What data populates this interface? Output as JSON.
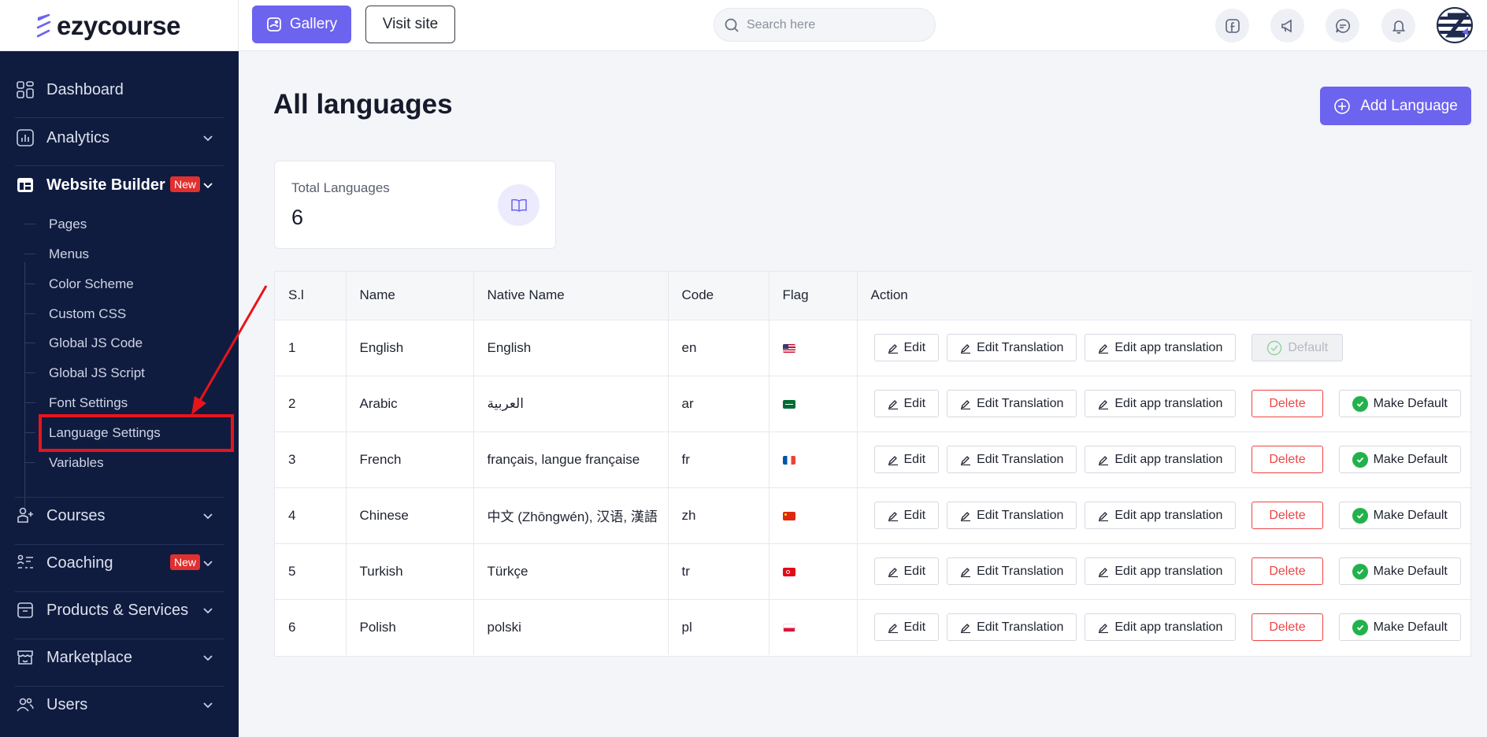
{
  "brand": {
    "name": "ezycourse"
  },
  "topbar": {
    "gallery_label": "Gallery",
    "visit_label": "Visit site",
    "search_placeholder": "Search here"
  },
  "sidebar": {
    "items": [
      {
        "label": "Dashboard",
        "icon": "dashboard-icon"
      },
      {
        "label": "Analytics",
        "icon": "analytics-icon"
      },
      {
        "label": "Website Builder",
        "icon": "website-builder-icon",
        "badge": "New"
      },
      {
        "label": "Courses",
        "icon": "courses-icon"
      },
      {
        "label": "Coaching",
        "icon": "coaching-icon",
        "badge": "New"
      },
      {
        "label": "Products & Services",
        "icon": "products-icon"
      },
      {
        "label": "Marketplace",
        "icon": "marketplace-icon"
      },
      {
        "label": "Users",
        "icon": "users-icon"
      }
    ],
    "submenu": [
      "Pages",
      "Menus",
      "Color Scheme",
      "Custom CSS",
      "Global JS Code",
      "Global JS Script",
      "Font Settings",
      "Language Settings",
      "Variables"
    ]
  },
  "main": {
    "title": "All languages",
    "add_label": "Add Language",
    "stat": {
      "label": "Total Languages",
      "value": "6"
    },
    "table": {
      "headers": [
        "S.l",
        "Name",
        "Native Name",
        "Code",
        "Flag",
        "Action"
      ],
      "rows": [
        {
          "sl": "1",
          "name": "English",
          "native": "English",
          "code": "en",
          "flag": "us-flag",
          "is_default": true
        },
        {
          "sl": "2",
          "name": "Arabic",
          "native": "العربية",
          "code": "ar",
          "flag": "sa-flag",
          "is_default": false
        },
        {
          "sl": "3",
          "name": "French",
          "native": "français, langue française",
          "code": "fr",
          "flag": "fr-flag",
          "is_default": false
        },
        {
          "sl": "4",
          "name": "Chinese",
          "native": "中文 (Zhōngwén), 汉语, 漢語",
          "code": "zh",
          "flag": "cn-flag",
          "is_default": false
        },
        {
          "sl": "5",
          "name": "Turkish",
          "native": "Türkçe",
          "code": "tr",
          "flag": "tr-flag",
          "is_default": false
        },
        {
          "sl": "6",
          "name": "Polish",
          "native": "polski",
          "code": "pl",
          "flag": "pl-flag",
          "is_default": false
        }
      ],
      "action_labels": {
        "edit": "Edit",
        "edit_translation": "Edit Translation",
        "edit_app_translation": "Edit app translation",
        "delete": "Delete",
        "make_default": "Make Default",
        "default": "Default"
      }
    }
  },
  "colors": {
    "accent": "#6c63ef",
    "sidebar": "#0f1c3f",
    "danger": "#ef4444",
    "success": "#22b24c",
    "annotation": "#e8141b"
  }
}
